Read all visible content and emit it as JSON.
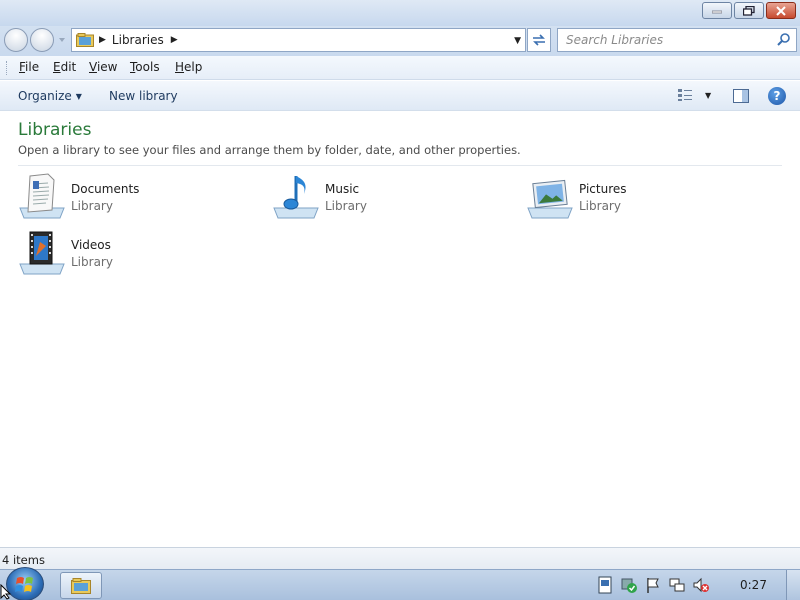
{
  "window": {
    "caption": {
      "minimize": "minimize",
      "maximize": "restore",
      "close": "close"
    }
  },
  "address": {
    "path": "Libraries"
  },
  "search": {
    "placeholder": "Search Libraries"
  },
  "menu": [
    {
      "label": "File",
      "underline": "F"
    },
    {
      "label": "Edit",
      "underline": "E"
    },
    {
      "label": "View",
      "underline": "V"
    },
    {
      "label": "Tools",
      "underline": "T"
    },
    {
      "label": "Help",
      "underline": "H"
    }
  ],
  "commands": {
    "organize": "Organize",
    "new_library": "New library"
  },
  "content": {
    "title": "Libraries",
    "subtitle": "Open a library to see your files and arrange them by folder, date, and other properties.",
    "libraries": [
      {
        "name": "Documents",
        "type": "Library",
        "icon": "documents-library-icon"
      },
      {
        "name": "Music",
        "type": "Library",
        "icon": "music-library-icon"
      },
      {
        "name": "Pictures",
        "type": "Library",
        "icon": "pictures-library-icon"
      },
      {
        "name": "Videos",
        "type": "Library",
        "icon": "videos-library-icon"
      }
    ]
  },
  "status": {
    "items": "4 items"
  },
  "taskbar": {
    "clock": "0:27"
  },
  "colors": {
    "heading": "#2a7a3a",
    "accent": "#1d56a8"
  }
}
